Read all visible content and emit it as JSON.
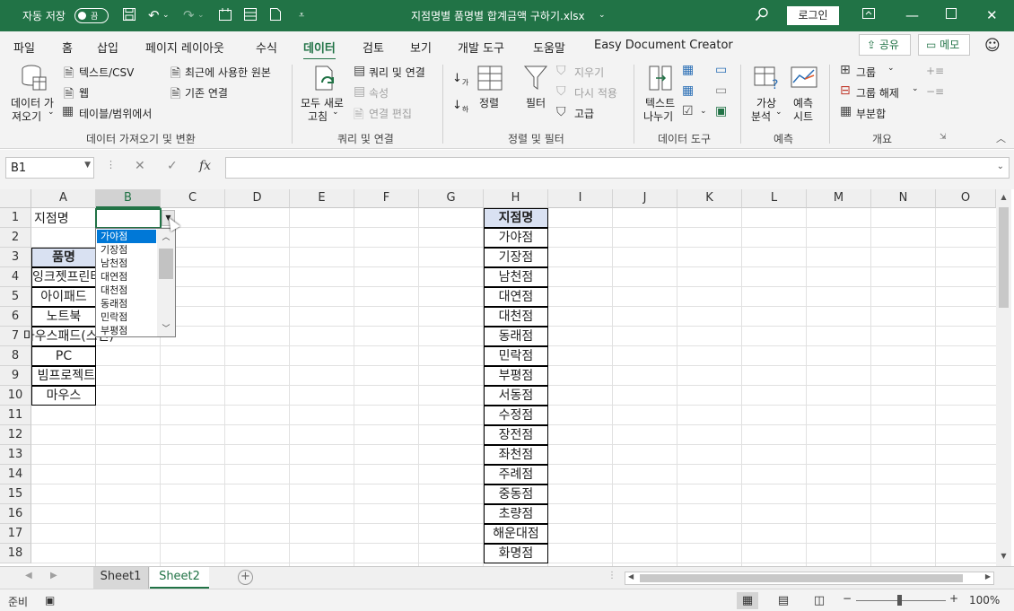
{
  "titlebar": {
    "autosave_label": "자동 저장",
    "autosave_state": "끔",
    "file_title": "지점명별 품명별 합계금액 구하기.xlsx",
    "login_label": "로그인"
  },
  "menu": {
    "tabs": [
      "파일",
      "홈",
      "삽입",
      "페이지 레이아웃",
      "수식",
      "데이터",
      "검토",
      "보기",
      "개발 도구",
      "도움말",
      "Easy Document Creator"
    ],
    "active": "데이터",
    "share_label": "공유",
    "memo_label": "메모"
  },
  "ribbon": {
    "get_data": {
      "line1": "데이터 가",
      "line2": "져오기"
    },
    "text_csv": "텍스트/CSV",
    "web": "웹",
    "table_range": "테이블/범위에서",
    "recent_sources": "최근에 사용한 원본",
    "existing_conn": "기존 연결",
    "group1_label": "데이터 가져오기 및 변환",
    "refresh_all": {
      "line1": "모두 새로",
      "line2": "고침"
    },
    "queries_conn": "쿼리 및 연결",
    "properties": "속성",
    "edit_links": "연결 편집",
    "group2_label": "쿼리 및 연결",
    "sort": "정렬",
    "filter": "필터",
    "clear": "지우기",
    "reapply": "다시 적용",
    "advanced": "고급",
    "group3_label": "정렬 및 필터",
    "text_to_cols": {
      "line1": "텍스트",
      "line2": "나누기"
    },
    "group4_label": "데이터 도구",
    "whatif": {
      "line1": "가상",
      "line2": "분석"
    },
    "forecast_sheet": {
      "line1": "예측",
      "line2": "시트"
    },
    "group5_label": "예측",
    "group_btn": "그룹",
    "ungroup_btn": "그룹 해제",
    "subtotal_btn": "부분합",
    "group6_label": "개요"
  },
  "formula_bar": {
    "name_box": "B1",
    "fx": "fx",
    "formula": ""
  },
  "columns": [
    "A",
    "B",
    "C",
    "D",
    "E",
    "F",
    "G",
    "H",
    "I",
    "J",
    "K",
    "L",
    "M",
    "N",
    "O"
  ],
  "rows": [
    "1",
    "2",
    "3",
    "4",
    "5",
    "6",
    "7",
    "8",
    "9",
    "10",
    "11",
    "12",
    "13",
    "14",
    "15",
    "16",
    "17",
    "18"
  ],
  "cells": {
    "a1": "지점명",
    "a3": "품명",
    "items": [
      "잉크젯프린터",
      "아이패드",
      "노트북",
      "마우스패드(스킨)",
      "PC",
      "빔프로젝트",
      "마우스"
    ]
  },
  "branch_table": {
    "header": "지점명",
    "values": [
      "가야점",
      "기장점",
      "남천점",
      "대연점",
      "대천점",
      "동래점",
      "민락점",
      "부평점",
      "서동점",
      "수정점",
      "장전점",
      "좌천점",
      "주례점",
      "중동점",
      "초량점",
      "해운대점",
      "화명점"
    ]
  },
  "dropdown": {
    "options": [
      "가야점",
      "기장점",
      "남천점",
      "대연점",
      "대천점",
      "동래점",
      "민락점",
      "부평점"
    ],
    "highlighted": "가야점"
  },
  "sheets": {
    "tabs": [
      "Sheet1",
      "Sheet2"
    ],
    "active": "Sheet2"
  },
  "status": {
    "mode": "준비",
    "zoom": "100%"
  }
}
